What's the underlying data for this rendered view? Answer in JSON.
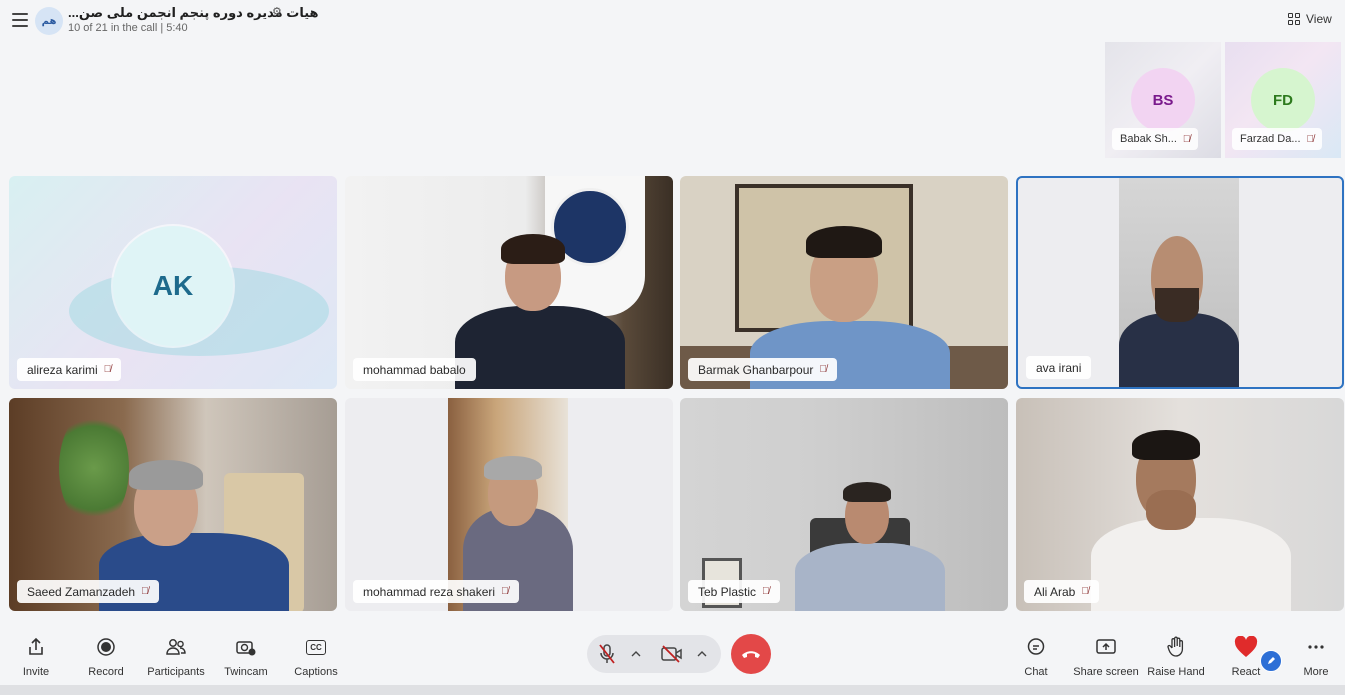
{
  "header": {
    "avatar_initials": "هم",
    "call_title": "هیات مدیره دوره پنجم انجمن ملی صن...",
    "call_subtitle": "10 of 21 in the call | 5:40",
    "view_label": "View"
  },
  "mini_participants": [
    {
      "initials": "BS",
      "name": "Babak Sh...",
      "avatar_color": "#f2d4f2",
      "initials_color": "#7a1a8c"
    },
    {
      "initials": "FD",
      "name": "Farzad Da...",
      "avatar_color": "#d6f5cf",
      "initials_color": "#2d7a1d"
    }
  ],
  "tiles": [
    {
      "name": "alireza karimi",
      "initials": "AK"
    },
    {
      "name": "mohammad babalo"
    },
    {
      "name": "Barmak Ghanbarpour"
    },
    {
      "name": "ava irani"
    },
    {
      "name": "Saeed Zamanzadeh"
    },
    {
      "name": "mohammad reza shakeri"
    },
    {
      "name": "Teb Plastic"
    },
    {
      "name": "Ali Arab"
    }
  ],
  "toolbar": {
    "invite": "Invite",
    "record": "Record",
    "participants": "Participants",
    "twincam": "Twincam",
    "captions": "Captions",
    "captions_icon_text": "CC",
    "chat": "Chat",
    "share_screen": "Share screen",
    "raise_hand": "Raise Hand",
    "react": "React",
    "more": "More"
  },
  "colors": {
    "accent": "#2e73c2",
    "end_call": "#e34848",
    "react_heart": "#e02b2b"
  }
}
